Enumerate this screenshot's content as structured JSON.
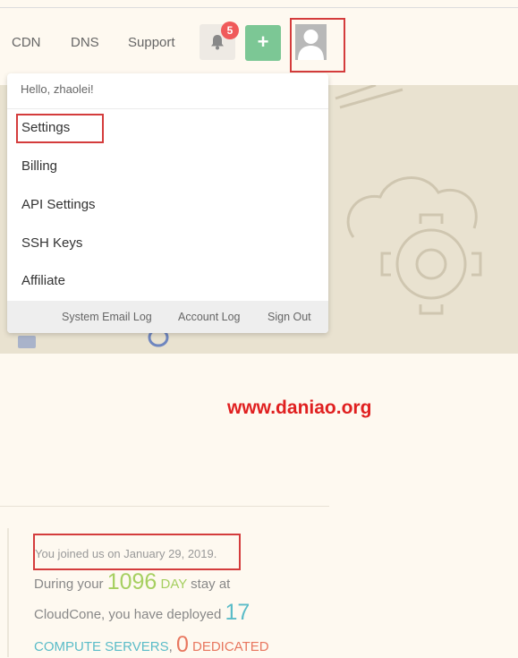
{
  "nav": {
    "links": [
      "CDN",
      "DNS",
      "Support"
    ],
    "notification_count": "5",
    "plus_label": "+"
  },
  "dropdown": {
    "greeting": "Hello, zhaolei!",
    "items": [
      "Settings",
      "Billing",
      "API Settings",
      "SSH Keys",
      "Affiliate"
    ],
    "footer_links": [
      "System Email Log",
      "Account Log",
      "Sign Out"
    ]
  },
  "watermark": "www.daniao.org",
  "stats": {
    "joined": "You joined us on January 29, 2019.",
    "during": "During your",
    "days": "1096",
    "day_label": "DAY",
    "stay_at": "stay at",
    "cloudcone": "CloudCone, you have deployed",
    "compute_count": "17",
    "compute_label": "COMPUTE SERVERS",
    "comma": ",",
    "dedicated_count": "0",
    "dedicated_label": "DEDICATED"
  },
  "colors": {
    "accent_green": "#7cc795",
    "badge_red": "#f05a5a",
    "highlight_red": "#d43c3c",
    "days_green": "#a6cf60",
    "compute_teal": "#5bbcc8",
    "dedicated_orange": "#e8775f"
  }
}
